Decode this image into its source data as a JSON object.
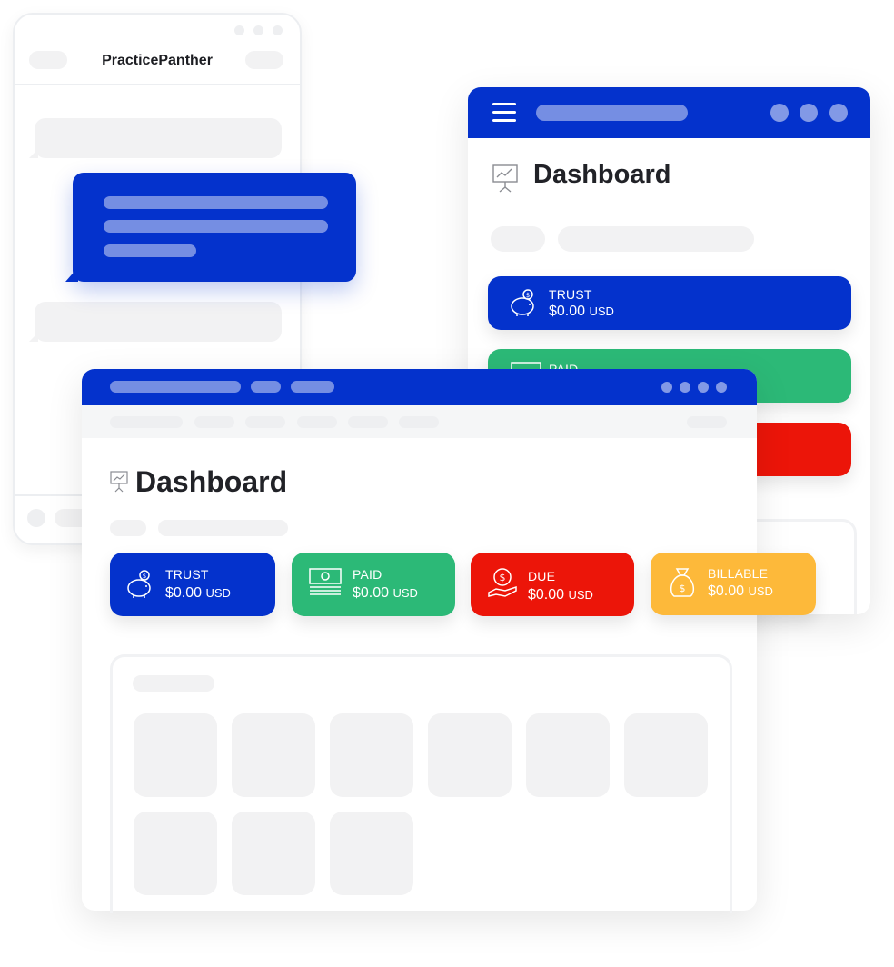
{
  "phone": {
    "title": "PracticePanther"
  },
  "right_window": {
    "dashboard_title": "Dashboard",
    "cards": [
      {
        "label": "TRUST",
        "amount": "$0.00",
        "currency": "USD",
        "color": "#0432cc",
        "icon": "piggy-bank-icon"
      },
      {
        "label": "PAID",
        "color": "#2cb977",
        "icon": "cash-icon"
      },
      {
        "color": "#ec1509"
      }
    ]
  },
  "main_window": {
    "dashboard_title": "Dashboard",
    "cards": [
      {
        "label": "TRUST",
        "amount": "$0.00",
        "currency": "USD",
        "color": "#0432cc",
        "icon": "piggy-bank-icon"
      },
      {
        "label": "PAID",
        "amount": "$0.00",
        "currency": "USD",
        "color": "#2cb977",
        "icon": "cash-icon"
      },
      {
        "label": "DUE",
        "amount": "$0.00",
        "currency": "USD",
        "color": "#ec1509",
        "icon": "hand-coin-icon"
      },
      {
        "label": "BILLABLE",
        "amount": "$0.00",
        "currency": "USD",
        "color": "#fdb93a",
        "icon": "money-bag-icon"
      }
    ]
  },
  "colors": {
    "brand_blue": "#0432cc",
    "placeholder_grey": "#f2f2f3",
    "text_dark": "#212227"
  }
}
